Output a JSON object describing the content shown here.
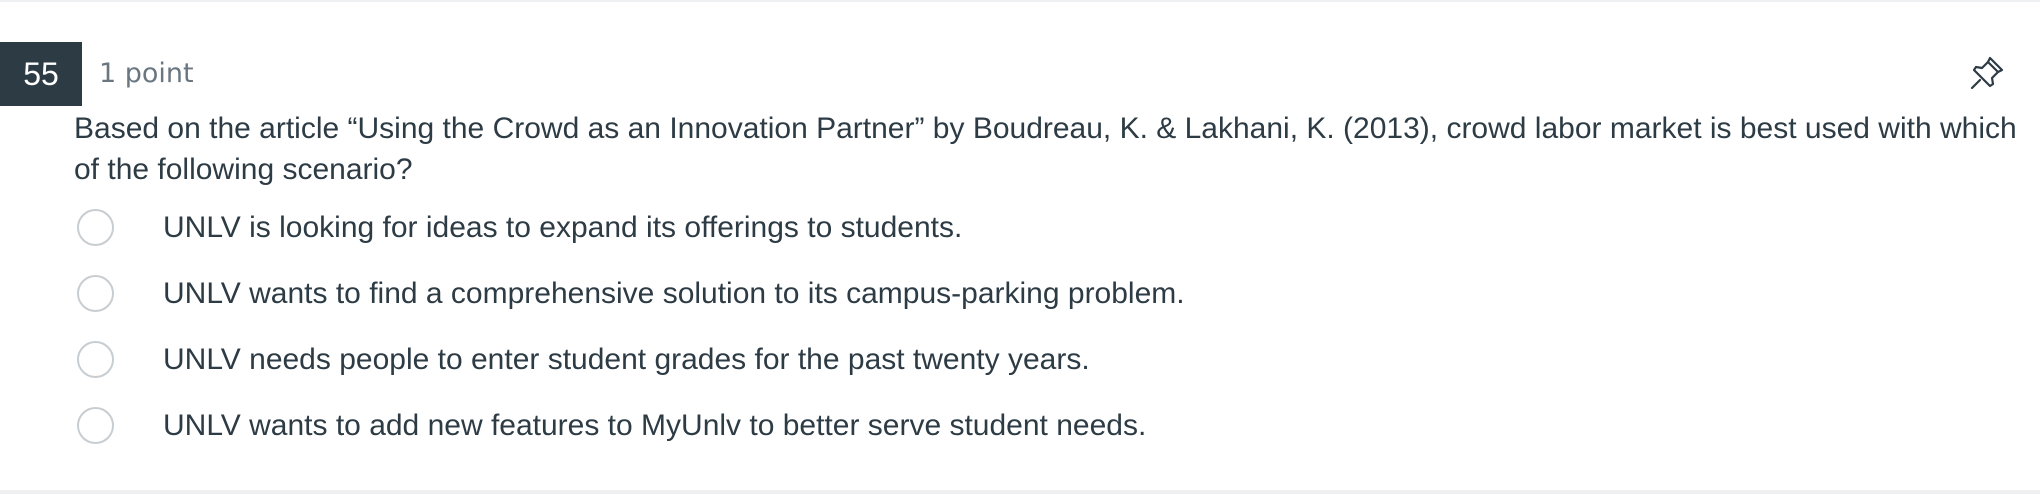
{
  "question": {
    "number": "55",
    "points": "1 point",
    "text": "Based on the article “Using the Crowd as an Innovation Partner” by Boudreau, K. & Lakhani, K. (2013), crowd labor market is best used with which of the following scenario?",
    "pin_icon": "pin-icon",
    "answers": [
      {
        "label": "UNLV is looking for ideas to expand its offerings to students.",
        "selected": false
      },
      {
        "label": "UNLV wants to find a comprehensive solution to its campus-parking problem.",
        "selected": false
      },
      {
        "label": "UNLV needs people to enter student grades for the past twenty years.",
        "selected": false
      },
      {
        "label": "UNLV wants to add new features to MyUnlv to better serve student needs.",
        "selected": false
      }
    ]
  },
  "colors": {
    "number_badge_bg": "#2d3b45",
    "text": "#2d3b45",
    "muted_text": "#6b7780",
    "radio_border": "#c7cdd1"
  }
}
